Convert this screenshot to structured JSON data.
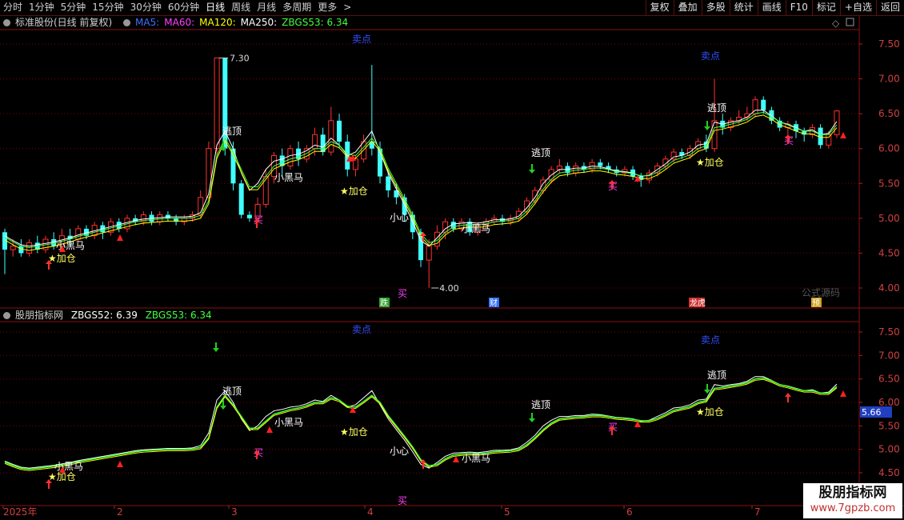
{
  "toolbar": {
    "periods": [
      "分时",
      "1分钟",
      "5分钟",
      "15分钟",
      "30分钟",
      "60分钟",
      "日线",
      "周线",
      "月线",
      "多周期",
      "更多"
    ],
    "active_period": "日线",
    "more_arrow": ">",
    "buttons": [
      "复权",
      "叠加",
      "多股",
      "统计",
      "画线",
      "F10",
      "标记",
      "+自选",
      "返回"
    ]
  },
  "main_panel": {
    "title": "标准股份(日线 前复权)",
    "ma_labels": [
      {
        "text": "MA5:",
        "color": "#4070ff"
      },
      {
        "text": "MA60:",
        "color": "#ff40ff"
      },
      {
        "text": "MA120:",
        "color": "#ffff00"
      },
      {
        "text": "MA250:",
        "color": "#ffffff"
      },
      {
        "text": "ZBGS53: 6.34",
        "color": "#40ff40"
      }
    ],
    "y_ticks": [
      "7.50",
      "7.00",
      "6.50",
      "6.00",
      "5.50",
      "5.00",
      "4.50",
      "4.00"
    ],
    "high_label": "7.30",
    "low_label": "4.00",
    "annotations": {
      "sell1": "卖点",
      "sell2": "卖点",
      "escape1": "逃顶",
      "escape2": "逃顶",
      "escape3": "逃顶",
      "add1": "★加仓",
      "add2": "★加仓",
      "add3": "★加仓",
      "horse1": "小黑马",
      "horse2": "小黑马",
      "horse3": "小黑马",
      "careful": "小心",
      "buy1": "买",
      "buy2": "买",
      "buy3": "买",
      "buy4": "买"
    },
    "events": [
      "跌",
      "财",
      "龙虎",
      "预"
    ],
    "formula_watermark": "公式源码"
  },
  "sub_panel": {
    "title": "股朋指标网",
    "zbgs52": "ZBGS52: 6.39",
    "zbgs53": "ZBGS53: 6.34",
    "zbgs52_color": "#ffffff",
    "zbgs53_color": "#40ff40",
    "y_ticks": [
      "7.50",
      "7.00",
      "6.50",
      "6.00",
      "5.50",
      "5.00",
      "4.50"
    ],
    "current_value": "5.66",
    "annotations": {
      "sell1": "卖点",
      "sell2": "卖点",
      "escape1": "逃顶",
      "escape2": "逃顶",
      "escape3": "逃顶",
      "add1": "★加仓",
      "add2": "★加仓",
      "add3": "★加仓",
      "horse1": "小黑马",
      "horse2": "小黑马",
      "horse3": "小黑马",
      "careful": "小心",
      "buy1": "买",
      "buy2": "买",
      "buy3": "买"
    }
  },
  "x_axis": {
    "labels": [
      "2025年",
      "2",
      "3",
      "4",
      "5",
      "6",
      "7"
    ]
  },
  "watermark": {
    "line1": "股朋指标网",
    "line2": "www.7gpzb.com"
  },
  "colors": {
    "up": "#ff3030",
    "down": "#40ffff",
    "grid": "#7a0000",
    "ma_white": "#ffffff",
    "ma_yellow": "#ffff00",
    "ma_green": "#40ff40"
  },
  "chart_data": {
    "type": "candlestick",
    "y_range": [
      3.8,
      7.8
    ],
    "high_marker": 7.3,
    "low_marker": 4.0,
    "last_zbgs52": 6.39,
    "last_zbgs53": 6.34,
    "series_note": "",
    "candles": [
      [
        4.8,
        4.55,
        4.85,
        4.2
      ],
      [
        4.55,
        4.6,
        4.7,
        4.45
      ],
      [
        4.6,
        4.5,
        4.7,
        4.45
      ],
      [
        4.5,
        4.65,
        4.7,
        4.45
      ],
      [
        4.65,
        4.55,
        4.75,
        4.5
      ],
      [
        4.55,
        4.7,
        4.75,
        4.5
      ],
      [
        4.7,
        4.6,
        4.8,
        4.55
      ],
      [
        4.6,
        4.75,
        4.85,
        4.55
      ],
      [
        4.75,
        4.7,
        4.85,
        4.6
      ],
      [
        4.7,
        4.85,
        4.9,
        4.65
      ],
      [
        4.85,
        4.75,
        4.9,
        4.7
      ],
      [
        4.75,
        4.9,
        4.95,
        4.7
      ],
      [
        4.9,
        4.8,
        4.95,
        4.7
      ],
      [
        4.8,
        4.95,
        5.0,
        4.75
      ],
      [
        4.95,
        4.85,
        5.0,
        4.8
      ],
      [
        4.85,
        5.0,
        5.05,
        4.8
      ],
      [
        5.0,
        4.95,
        5.05,
        4.9
      ],
      [
        4.95,
        5.05,
        5.1,
        4.9
      ],
      [
        5.05,
        4.95,
        5.1,
        4.9
      ],
      [
        4.95,
        5.05,
        5.1,
        4.9
      ],
      [
        5.05,
        5.0,
        5.1,
        4.95
      ],
      [
        5.0,
        4.95,
        5.05,
        4.9
      ],
      [
        4.95,
        5.0,
        5.05,
        4.9
      ],
      [
        5.0,
        5.05,
        5.1,
        4.95
      ],
      [
        5.05,
        5.3,
        5.4,
        5.0
      ],
      [
        5.3,
        6.0,
        6.1,
        5.25
      ],
      [
        6.0,
        7.3,
        7.3,
        5.9
      ],
      [
        7.3,
        6.0,
        7.3,
        5.9
      ],
      [
        6.0,
        5.5,
        6.1,
        5.4
      ],
      [
        5.5,
        5.05,
        5.55,
        5.0
      ],
      [
        5.05,
        5.0,
        5.1,
        4.95
      ],
      [
        5.0,
        5.2,
        5.3,
        4.95
      ],
      [
        5.2,
        5.6,
        5.7,
        5.15
      ],
      [
        5.6,
        5.9,
        5.95,
        5.5
      ],
      [
        5.9,
        5.75,
        6.0,
        5.6
      ],
      [
        5.75,
        6.0,
        6.05,
        5.7
      ],
      [
        6.0,
        5.85,
        6.1,
        5.75
      ],
      [
        5.85,
        6.0,
        6.05,
        5.8
      ],
      [
        6.0,
        6.2,
        6.3,
        5.9
      ],
      [
        6.2,
        5.95,
        6.3,
        5.9
      ],
      [
        5.95,
        6.4,
        6.6,
        5.9
      ],
      [
        6.4,
        6.1,
        6.5,
        6.0
      ],
      [
        6.1,
        5.7,
        6.2,
        5.6
      ],
      [
        5.7,
        5.85,
        5.9,
        5.6
      ],
      [
        5.85,
        6.1,
        6.2,
        5.8
      ],
      [
        6.1,
        6.0,
        7.2,
        5.9
      ],
      [
        6.0,
        5.6,
        6.1,
        5.5
      ],
      [
        5.6,
        5.4,
        5.7,
        5.3
      ],
      [
        5.4,
        5.3,
        5.5,
        5.2
      ],
      [
        5.3,
        5.05,
        5.35,
        4.95
      ],
      [
        5.05,
        4.8,
        5.1,
        4.7
      ],
      [
        4.8,
        4.4,
        4.85,
        4.3
      ],
      [
        4.4,
        4.6,
        4.7,
        4.0
      ],
      [
        4.6,
        4.8,
        4.9,
        4.55
      ],
      [
        4.8,
        4.95,
        5.0,
        4.7
      ],
      [
        4.95,
        4.85,
        5.0,
        4.8
      ],
      [
        4.85,
        4.95,
        5.0,
        4.8
      ],
      [
        4.95,
        4.8,
        5.0,
        4.75
      ],
      [
        4.8,
        4.9,
        4.95,
        4.75
      ],
      [
        4.9,
        4.95,
        5.0,
        4.85
      ],
      [
        4.95,
        5.0,
        5.05,
        4.9
      ],
      [
        5.0,
        4.95,
        5.05,
        4.9
      ],
      [
        4.95,
        5.0,
        5.05,
        4.9
      ],
      [
        5.0,
        5.1,
        5.15,
        4.95
      ],
      [
        5.1,
        5.25,
        5.3,
        5.05
      ],
      [
        5.25,
        5.4,
        5.45,
        5.2
      ],
      [
        5.4,
        5.55,
        5.6,
        5.35
      ],
      [
        5.55,
        5.7,
        5.75,
        5.5
      ],
      [
        5.7,
        5.75,
        5.85,
        5.65
      ],
      [
        5.75,
        5.65,
        5.8,
        5.6
      ],
      [
        5.65,
        5.75,
        5.8,
        5.6
      ],
      [
        5.75,
        5.7,
        5.8,
        5.65
      ],
      [
        5.7,
        5.8,
        5.85,
        5.65
      ],
      [
        5.8,
        5.75,
        5.85,
        5.7
      ],
      [
        5.75,
        5.7,
        5.8,
        5.65
      ],
      [
        5.7,
        5.65,
        5.75,
        5.6
      ],
      [
        5.65,
        5.7,
        5.75,
        5.6
      ],
      [
        5.7,
        5.6,
        5.75,
        5.55
      ],
      [
        5.6,
        5.55,
        5.65,
        5.45
      ],
      [
        5.55,
        5.65,
        5.7,
        5.5
      ],
      [
        5.65,
        5.75,
        5.8,
        5.6
      ],
      [
        5.75,
        5.85,
        5.9,
        5.7
      ],
      [
        5.85,
        5.95,
        6.0,
        5.8
      ],
      [
        5.95,
        5.9,
        6.0,
        5.85
      ],
      [
        5.9,
        6.0,
        6.05,
        5.85
      ],
      [
        6.0,
        6.1,
        6.15,
        5.95
      ],
      [
        6.1,
        6.0,
        6.2,
        5.95
      ],
      [
        6.0,
        6.4,
        7.0,
        5.95
      ],
      [
        6.4,
        6.3,
        6.5,
        6.2
      ],
      [
        6.3,
        6.4,
        6.45,
        6.25
      ],
      [
        6.4,
        6.45,
        6.55,
        6.35
      ],
      [
        6.45,
        6.5,
        6.6,
        6.4
      ],
      [
        6.5,
        6.7,
        6.75,
        6.45
      ],
      [
        6.7,
        6.55,
        6.75,
        6.5
      ],
      [
        6.55,
        6.4,
        6.6,
        6.35
      ],
      [
        6.4,
        6.3,
        6.45,
        6.25
      ],
      [
        6.3,
        6.35,
        6.4,
        6.2
      ],
      [
        6.35,
        6.25,
        6.4,
        6.15
      ],
      [
        6.25,
        6.2,
        6.3,
        6.1
      ],
      [
        6.2,
        6.3,
        6.35,
        6.15
      ],
      [
        6.3,
        6.05,
        6.35,
        6.0
      ],
      [
        6.05,
        6.2,
        6.25,
        6.0
      ],
      [
        6.2,
        6.54,
        6.55,
        6.15
      ]
    ],
    "zbgs52": [
      4.75,
      4.68,
      4.62,
      4.6,
      4.62,
      4.64,
      4.66,
      4.69,
      4.72,
      4.76,
      4.79,
      4.82,
      4.85,
      4.88,
      4.91,
      4.94,
      4.97,
      4.99,
      5.0,
      5.01,
      5.02,
      5.02,
      5.02,
      5.03,
      5.08,
      5.35,
      6.05,
      6.25,
      6.0,
      5.65,
      5.4,
      5.5,
      5.7,
      5.82,
      5.85,
      5.9,
      5.92,
      5.97,
      6.05,
      6.02,
      6.15,
      6.05,
      5.9,
      5.95,
      6.1,
      6.25,
      5.95,
      5.65,
      5.42,
      5.2,
      4.95,
      4.68,
      4.6,
      4.72,
      4.85,
      4.92,
      4.93,
      4.94,
      4.93,
      4.95,
      4.98,
      4.98,
      4.99,
      5.03,
      5.15,
      5.3,
      5.5,
      5.62,
      5.7,
      5.7,
      5.72,
      5.72,
      5.75,
      5.74,
      5.71,
      5.68,
      5.67,
      5.65,
      5.6,
      5.62,
      5.7,
      5.78,
      5.88,
      5.9,
      5.95,
      6.05,
      6.07,
      6.38,
      6.35,
      6.38,
      6.4,
      6.45,
      6.55,
      6.55,
      6.47,
      6.38,
      6.35,
      6.3,
      6.25,
      6.27,
      6.2,
      6.22,
      6.39
    ],
    "zbgs53": [
      4.73,
      4.66,
      4.6,
      4.58,
      4.6,
      4.62,
      4.64,
      4.67,
      4.7,
      4.74,
      4.77,
      4.8,
      4.83,
      4.86,
      4.89,
      4.92,
      4.95,
      4.97,
      4.98,
      4.99,
      5.0,
      5.0,
      5.0,
      5.01,
      5.04,
      5.25,
      5.9,
      6.15,
      5.95,
      5.7,
      5.45,
      5.45,
      5.6,
      5.75,
      5.8,
      5.85,
      5.88,
      5.93,
      6.0,
      6.0,
      6.1,
      6.05,
      5.92,
      5.9,
      6.02,
      6.15,
      6.0,
      5.72,
      5.5,
      5.28,
      5.05,
      4.78,
      4.65,
      4.68,
      4.8,
      4.88,
      4.9,
      4.91,
      4.91,
      4.92,
      4.95,
      4.96,
      4.97,
      5.0,
      5.1,
      5.25,
      5.42,
      5.56,
      5.65,
      5.67,
      5.69,
      5.7,
      5.72,
      5.72,
      5.7,
      5.67,
      5.66,
      5.64,
      5.61,
      5.61,
      5.66,
      5.74,
      5.83,
      5.87,
      5.91,
      6.0,
      6.04,
      6.3,
      6.32,
      6.35,
      6.38,
      6.42,
      6.5,
      6.52,
      6.46,
      6.38,
      6.34,
      6.29,
      6.25,
      6.25,
      6.2,
      6.2,
      6.34
    ]
  }
}
